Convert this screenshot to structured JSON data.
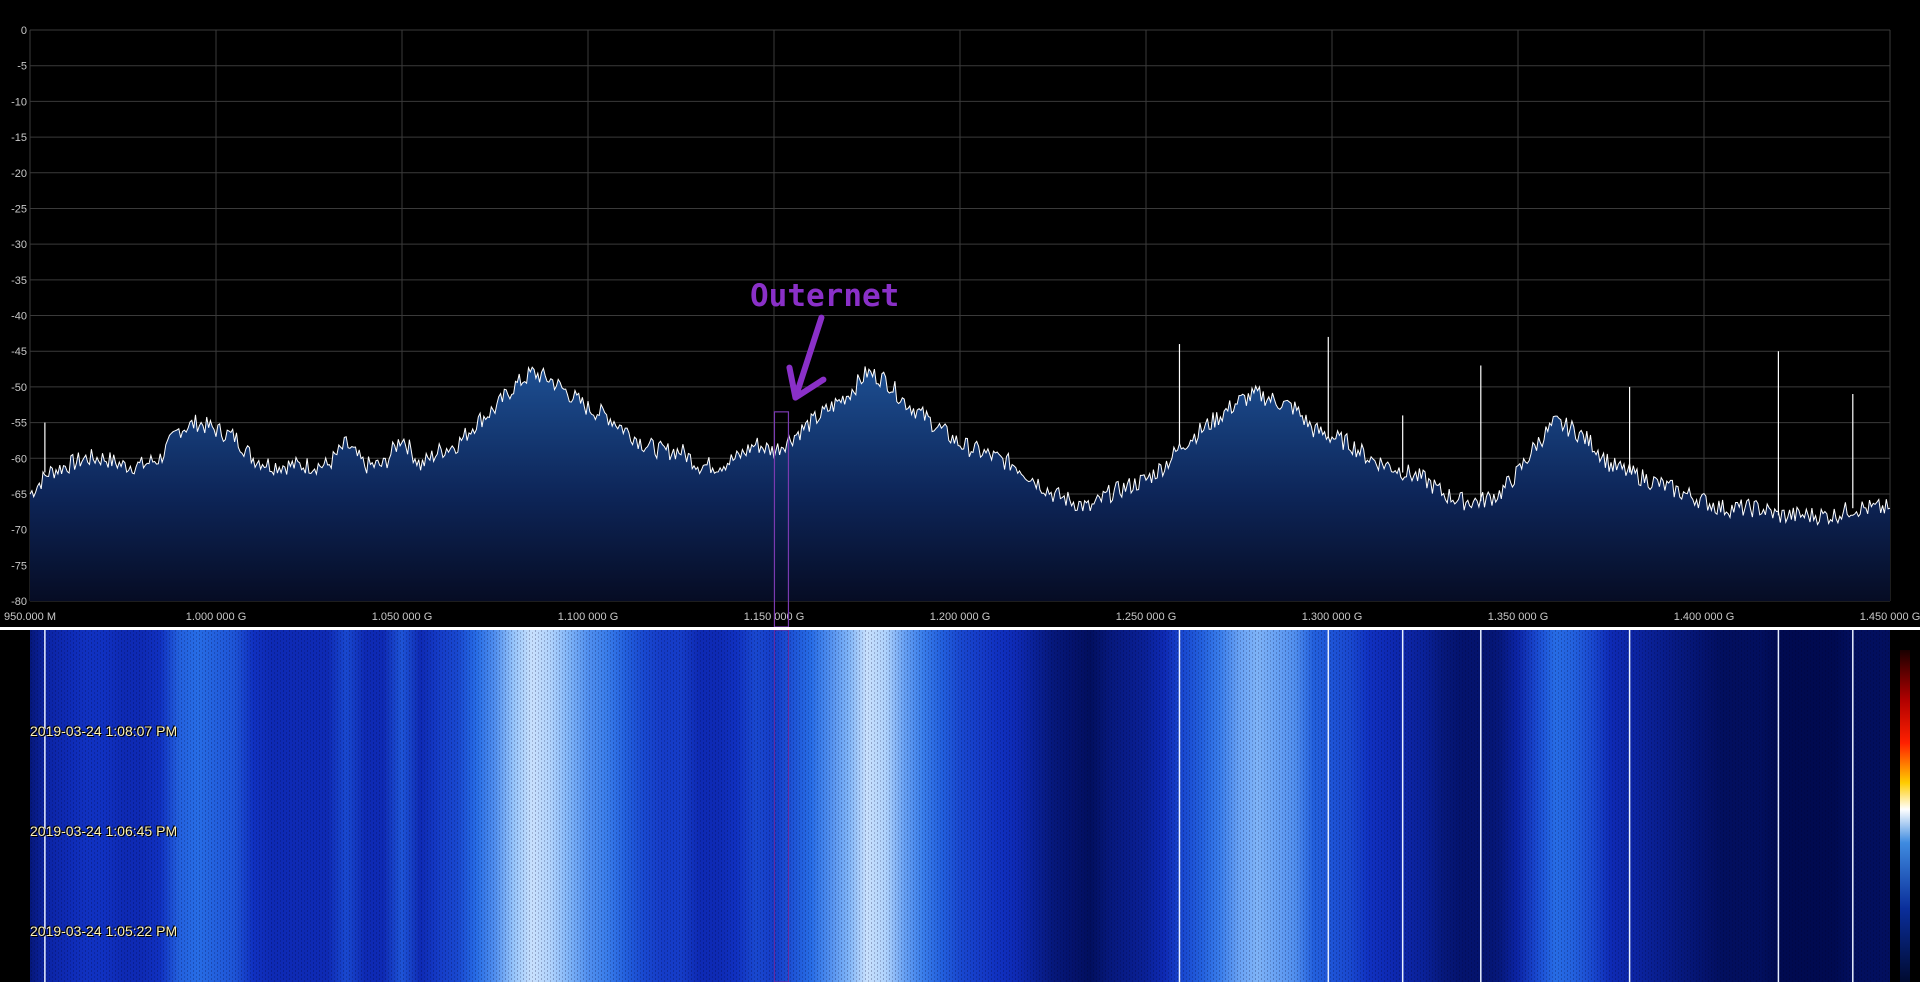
{
  "spectrum": {
    "y_ticks": [
      "0",
      "-5",
      "-10",
      "-15",
      "-20",
      "-25",
      "-30",
      "-35",
      "-40",
      "-45",
      "-50",
      "-55",
      "-60",
      "-65",
      "-70",
      "-75",
      "-80"
    ],
    "x_ticks": [
      "950.000 M",
      "1.000 000 G",
      "1.050 000 G",
      "1.100 000 G",
      "1.150 000 G",
      "1.200 000 G",
      "1.250 000 G",
      "1.300 000 G",
      "1.350 000 G",
      "1.400 000 G",
      "1.450 000 G"
    ]
  },
  "annotation": {
    "text": "Outernet"
  },
  "waterfall": {
    "timestamps": [
      "2019-03-24 1:08:07 PM",
      "2019-03-24 1:06:45 PM",
      "2019-03-24 1:05:22 PM"
    ]
  },
  "colors": {
    "grid": "#3a3a3a",
    "trace": "#ffffff",
    "fill_top": "#1d4f92",
    "fill_bottom": "#060c24",
    "annotation": "#8a30c8",
    "separator": "#ffffff"
  },
  "chart_data": {
    "type": "area",
    "xlabel": "",
    "ylabel": "",
    "xlim": [
      950,
      1450
    ],
    "ylim": [
      -80,
      0
    ],
    "x_unit": "MHz",
    "y_unit": "dB",
    "grid": true,
    "x": [
      950,
      955,
      960,
      965,
      970,
      975,
      980,
      985,
      990,
      995,
      1000,
      1005,
      1010,
      1015,
      1020,
      1025,
      1030,
      1035,
      1040,
      1045,
      1050,
      1055,
      1060,
      1065,
      1070,
      1075,
      1080,
      1085,
      1090,
      1095,
      1100,
      1105,
      1110,
      1115,
      1120,
      1125,
      1130,
      1135,
      1140,
      1145,
      1150,
      1155,
      1160,
      1165,
      1170,
      1175,
      1180,
      1185,
      1190,
      1195,
      1200,
      1205,
      1210,
      1215,
      1220,
      1225,
      1230,
      1235,
      1240,
      1245,
      1250,
      1255,
      1260,
      1265,
      1270,
      1275,
      1280,
      1285,
      1290,
      1295,
      1300,
      1305,
      1310,
      1315,
      1320,
      1325,
      1330,
      1335,
      1340,
      1345,
      1350,
      1355,
      1360,
      1365,
      1370,
      1375,
      1380,
      1385,
      1390,
      1395,
      1400,
      1405,
      1410,
      1415,
      1420,
      1425,
      1430,
      1435,
      1440,
      1445,
      1450
    ],
    "y": [
      -65,
      -62,
      -61,
      -60,
      -60,
      -61,
      -61,
      -60,
      -56,
      -55,
      -56,
      -57,
      -60,
      -61,
      -61,
      -61,
      -61,
      -58,
      -61,
      -61,
      -57,
      -61,
      -59,
      -58,
      -55,
      -53,
      -50,
      -48,
      -49,
      -51,
      -53,
      -54,
      -56,
      -58,
      -59,
      -59,
      -61,
      -61,
      -60,
      -58,
      -59,
      -57,
      -55,
      -53,
      -51,
      -48,
      -49,
      -52,
      -54,
      -56,
      -58,
      -59,
      -60,
      -61,
      -63,
      -65,
      -66,
      -67,
      -65,
      -64,
      -63,
      -61,
      -58,
      -56,
      -54,
      -52,
      -51,
      -52,
      -53,
      -56,
      -57,
      -58,
      -60,
      -61,
      -62,
      -63,
      -65,
      -66,
      -66,
      -65,
      -62,
      -58,
      -55,
      -56,
      -58,
      -61,
      -62,
      -63,
      -64,
      -65,
      -66,
      -67,
      -67,
      -67,
      -68,
      -68,
      -68,
      -68,
      -67,
      -67,
      -67
    ],
    "spikes": [
      {
        "x": 954,
        "y": -55
      },
      {
        "x": 1259,
        "y": -44
      },
      {
        "x": 1299,
        "y": -43
      },
      {
        "x": 1319,
        "y": -54
      },
      {
        "x": 1340,
        "y": -47
      },
      {
        "x": 1380,
        "y": -50
      },
      {
        "x": 1420,
        "y": -45
      },
      {
        "x": 1440,
        "y": -51
      }
    ],
    "annotation_x": 1152
  }
}
